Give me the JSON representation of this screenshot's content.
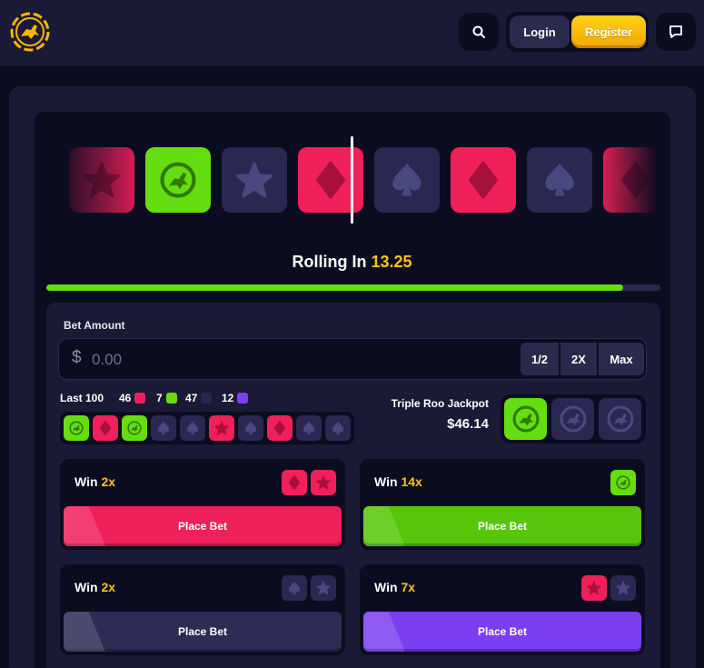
{
  "header": {
    "login_label": "Login",
    "register_label": "Register"
  },
  "reel": {
    "tiles": [
      "star",
      "kangaroo",
      "star",
      "diamond",
      "spade",
      "diamond",
      "spade",
      "diamond"
    ]
  },
  "round": {
    "prefix": "Rolling In",
    "timer": "13.25",
    "progress_fraction": 0.94
  },
  "bet": {
    "label": "Bet Amount",
    "currency": "$",
    "placeholder": "0.00",
    "value": "",
    "quick": [
      "1/2",
      "2X",
      "Max"
    ]
  },
  "stats": {
    "label": "Last 100",
    "counts": [
      {
        "value": "46",
        "color": "#f0205a"
      },
      {
        "value": "7",
        "color": "#66dd10"
      },
      {
        "value": "47",
        "color": "#2a2850"
      },
      {
        "value": "12",
        "color": "#7c3ff0"
      }
    ],
    "history": [
      "kangaroo",
      "diamond",
      "kangaroo",
      "spade",
      "spade",
      "star",
      "spade",
      "diamond",
      "spade",
      "spade"
    ]
  },
  "jackpot": {
    "title": "Triple Roo Jackpot",
    "value": "$46.14",
    "slots_filled": 1
  },
  "cards": [
    {
      "win": "Win",
      "mult": "2x",
      "button": "Place Bet",
      "badges": [
        "diamond",
        "star"
      ]
    },
    {
      "win": "Win",
      "mult": "14x",
      "button": "Place Bet",
      "badges": [
        "kangaroo"
      ]
    },
    {
      "win": "Win",
      "mult": "2x",
      "button": "Place Bet",
      "badges": [
        "spade",
        "star"
      ]
    },
    {
      "win": "Win",
      "mult": "7x",
      "button": "Place Bet",
      "badges": [
        "star",
        "star"
      ]
    }
  ],
  "colors": {
    "accent_yellow": "#ffc21a",
    "red": "#f0205a",
    "green": "#66dd10",
    "purple": "#2a2850",
    "violet": "#7c3ff0"
  }
}
